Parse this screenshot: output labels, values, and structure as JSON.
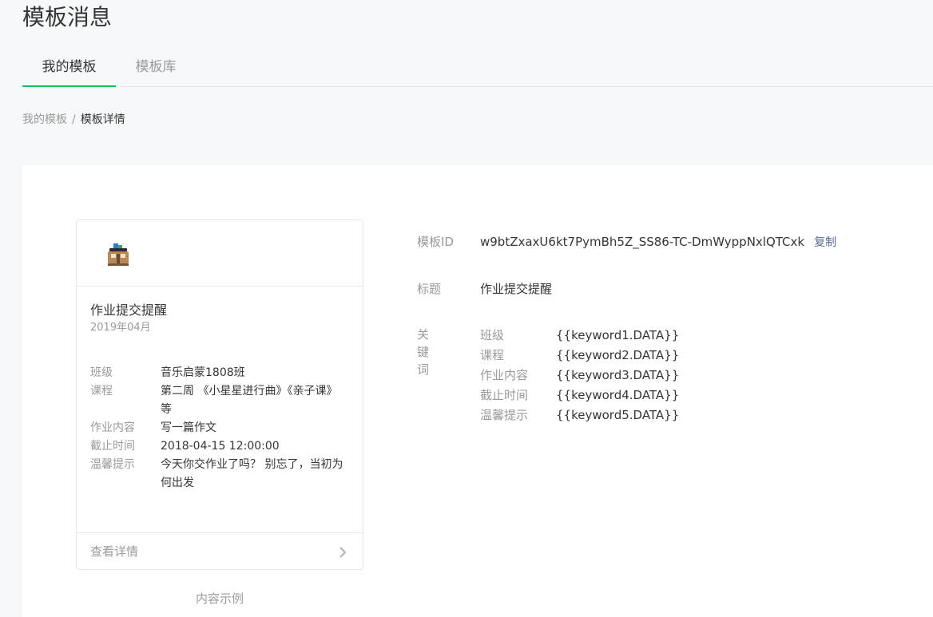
{
  "header": {
    "title": "模板消息"
  },
  "tabs": [
    {
      "label": "我的模板",
      "active": true
    },
    {
      "label": "模板库",
      "active": false
    }
  ],
  "breadcrumb": {
    "parent": "我的模板",
    "separator": "/",
    "current": "模板详情"
  },
  "card": {
    "logo_icon": "app-logo-icon",
    "title": "作业提交提醒",
    "date": "2019年04月",
    "fields": [
      {
        "key": "班级",
        "value": "音乐启蒙1808班"
      },
      {
        "key": "课程",
        "value": "第二周 《小星星进行曲》《亲子课》等"
      },
      {
        "key": "作业内容",
        "value": "写一篇作文"
      },
      {
        "key": "截止时间",
        "value": "2018-04-15 12:00:00"
      },
      {
        "key": "温馨提示",
        "value": "今天你交作业了吗？ 别忘了，当初为何出发"
      }
    ],
    "footer_label": "查看详情",
    "footer_icon": "chevron-right-icon"
  },
  "sample_caption": "内容示例",
  "info": {
    "template_id_label": "模板ID",
    "template_id": "w9btZxaxU6kt7PymBh5Z_SS86-TC-DmWyppNxlQTCxk",
    "copy_label": "复制",
    "title_label": "标题",
    "title": "作业提交提醒",
    "keywords_label": "关键词",
    "keywords": [
      {
        "name": "班级",
        "value": "{{keyword1.DATA}}"
      },
      {
        "name": "课程",
        "value": "{{keyword2.DATA}}"
      },
      {
        "name": "作业内容",
        "value": "{{keyword3.DATA}}"
      },
      {
        "name": "截止时间",
        "value": "{{keyword4.DATA}}"
      },
      {
        "name": "温馨提示",
        "value": "{{keyword5.DATA}}"
      }
    ]
  },
  "colors": {
    "accent_green": "#07c160",
    "link_blue": "#576b95",
    "muted": "#9a9a9a",
    "text": "#353535"
  }
}
